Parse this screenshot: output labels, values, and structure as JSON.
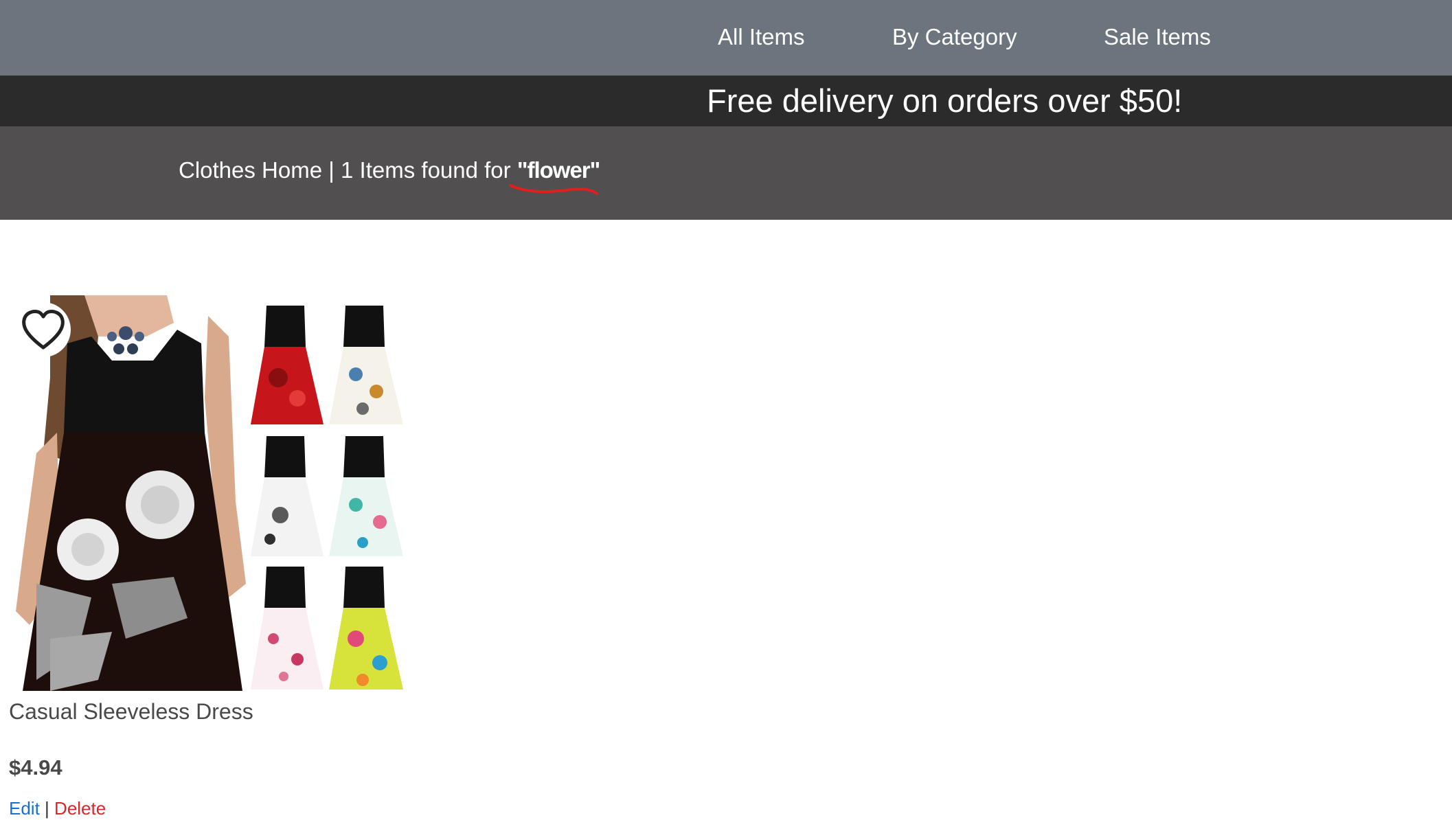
{
  "colors": {
    "nav_bg": "#6c757d",
    "promo_bg": "#2b2b2b",
    "crumb_bg": "#514f50",
    "edit_link": "#1a6fd4",
    "delete_link": "#d9262c",
    "underline_annotation": "#e0201c"
  },
  "nav": {
    "items": [
      {
        "label": "All Items"
      },
      {
        "label": "By Category"
      },
      {
        "label": "Sale Items"
      }
    ]
  },
  "promo": {
    "text": "Free delivery on orders over $50!"
  },
  "breadcrumb": {
    "home": "Clothes Home",
    "separator": "|",
    "count": "1",
    "found_text": "Items found for",
    "search_term": "\"flower\""
  },
  "product": {
    "name": "Casual Sleeveless Dress",
    "price": "$4.94",
    "favorite_icon": "heart-outline-icon",
    "actions": {
      "edit": "Edit",
      "separator": "|",
      "delete": "Delete"
    }
  }
}
